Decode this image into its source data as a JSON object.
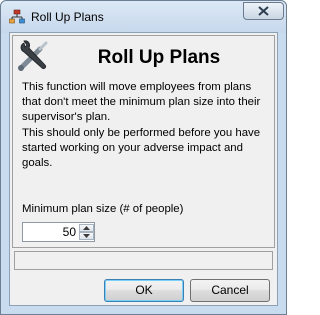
{
  "window": {
    "title": "Roll Up Plans"
  },
  "dialog": {
    "heading": "Roll Up Plans",
    "description_1": "This function will move employees from plans that don't meet the minimum plan size into their supervisor's plan.",
    "description_2": "This should only be performed before you have started working on your adverse impact and goals.",
    "min_plan_size_label": "Minimum plan size (# of people)",
    "min_plan_size_value": "50",
    "status_text": ""
  },
  "buttons": {
    "ok_label": "OK",
    "cancel_label": "Cancel"
  },
  "icons": {
    "app": "org-chart-icon",
    "tool": "tools-icon",
    "close": "close-icon"
  },
  "colors": {
    "titlebar": "#c6d8ec",
    "dialog_background": "#f0f0f0",
    "close_glyph": "#2c3e50",
    "default_button_border": "#3c7fb1"
  }
}
